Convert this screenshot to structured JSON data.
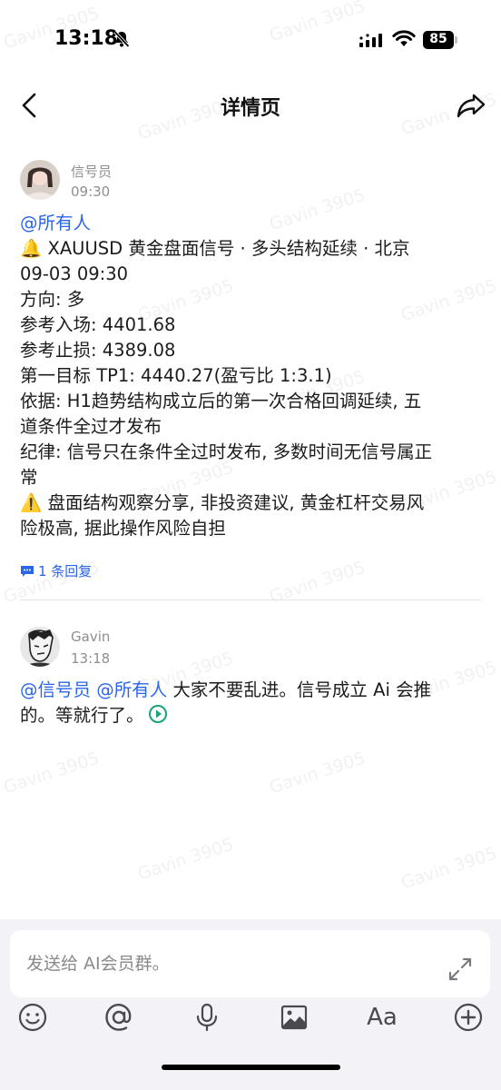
{
  "status_bar": {
    "time": "13:18",
    "battery": "85"
  },
  "nav": {
    "title": "详情页"
  },
  "messages": [
    {
      "sender": "信号员",
      "time": "09:30",
      "mention": "@所有人",
      "lines": {
        "l1": "🔔 XAUUSD 黄金盘面信号 · 多头结构延续 · 北京",
        "l2": "09-03 09:30",
        "l3": "方向: 多",
        "l4": "参考入场: 4401.68",
        "l5": "参考止损: 4389.08",
        "l6": "第一目标 TP1: 4440.27(盈亏比 1:3.1)",
        "l7": "依据: H1趋势结构成立后的第一次合格回调延续, 五",
        "l8": "道条件全过才发布",
        "l9": "纪律: 信号只在条件全过时发布, 多数时间无信号属正",
        "l10": "常",
        "l11": "⚠️  盘面结构观察分享, 非投资建议, 黄金杠杆交易风",
        "l12": "险极高, 据此操作风险自担"
      },
      "reply": "1 条回复"
    },
    {
      "sender": "Gavin",
      "time": "13:18",
      "mention1": "@信号员",
      "mention2": "@所有人",
      "text1": " 大家不要乱进。信号成立 Ai 会推",
      "text2": "的。等就行了。"
    }
  ],
  "watermark": "Gavin 3905",
  "compose": {
    "placeholder": "发送给 AI会员群。"
  },
  "toolbar": {
    "font_label": "Aa"
  },
  "colors": {
    "mention": "#2a64e8",
    "accent_clock": "#1aa37a",
    "bottom_bg": "#f2f2f7"
  }
}
